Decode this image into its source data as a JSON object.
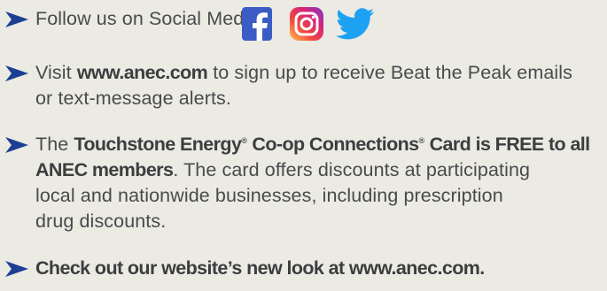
{
  "bullet1": {
    "text": "Follow us on Social Media:",
    "icons": [
      "facebook-icon",
      "instagram-icon",
      "twitter-icon"
    ],
    "colors": {
      "facebook": "#3b5cc4",
      "twitter": "#1da1f2",
      "arrow": "#1c3f94"
    }
  },
  "bullet2": {
    "pre": "Visit ",
    "link": "www.anec.com",
    "post": " to sign up to receive Beat the Peak emails",
    "line2": "or text-message alerts."
  },
  "bullet3": {
    "pre": "The ",
    "bold1": "Touchstone Energy",
    "reg1": "®",
    "bold2": " Co-op Connections",
    "reg2": "®",
    "bold3": " Card is FREE to all",
    "bold4": "ANEC members",
    "post4": ". The card offers discounts at participating",
    "line3": "local and nationwide businesses, including prescription",
    "line4": "drug discounts."
  },
  "bullet4": {
    "text": "Check out our website’s new look at www.anec.com."
  }
}
